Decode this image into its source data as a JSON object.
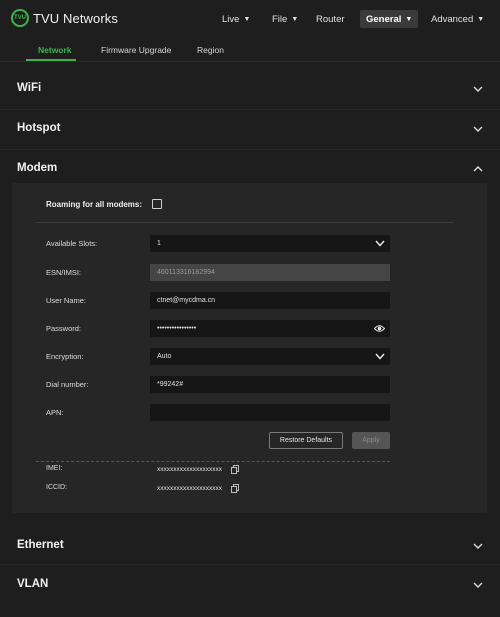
{
  "brand": {
    "badge": "TVU",
    "name": "TVU Networks"
  },
  "nav": {
    "live": "Live",
    "file": "File",
    "router": "Router",
    "general": "General",
    "advanced": "Advanced",
    "caret": "▼"
  },
  "tabs": {
    "network": "Network",
    "firmware": "Firmware Upgrade",
    "region": "Region"
  },
  "sections": {
    "wifi": "WiFi",
    "hotspot": "Hotspot",
    "modem": "Modem",
    "ethernet": "Ethernet",
    "vlan": "VLAN"
  },
  "modem": {
    "roaming_label": "Roaming for all modems:",
    "roaming_checked": false,
    "slots_label": "Available Slots:",
    "slots_value": "1",
    "esn_label": "ESN/IMSI:",
    "esn_value": "460113316182994",
    "username_label": "User Name:",
    "username_value": "ctnet@mycdma.cn",
    "password_label": "Password:",
    "password_value": "••••••••••••••••",
    "encryption_label": "Encryption:",
    "encryption_value": "Auto",
    "dial_label": "Dial number:",
    "dial_value": "*99242#",
    "apn_label": "APN:",
    "apn_value": "",
    "restore_label": "Restore Defaults",
    "apply_label": "Apply",
    "imei_label": "IMEI:",
    "imei_value": "xxxxxxxxxxxxxxxxxxxx",
    "iccid_label": "ICCID:",
    "iccid_value": "xxxxxxxxxxxxxxxxxxxx"
  },
  "colors": {
    "accent": "#3fb24f",
    "background": "#1e1e1e",
    "panel": "#262626"
  },
  "icons": [
    "tvu-logo-icon",
    "chevron-down-icon",
    "chevron-up-icon",
    "eye-icon",
    "copy-icon",
    "checkbox-icon"
  ]
}
